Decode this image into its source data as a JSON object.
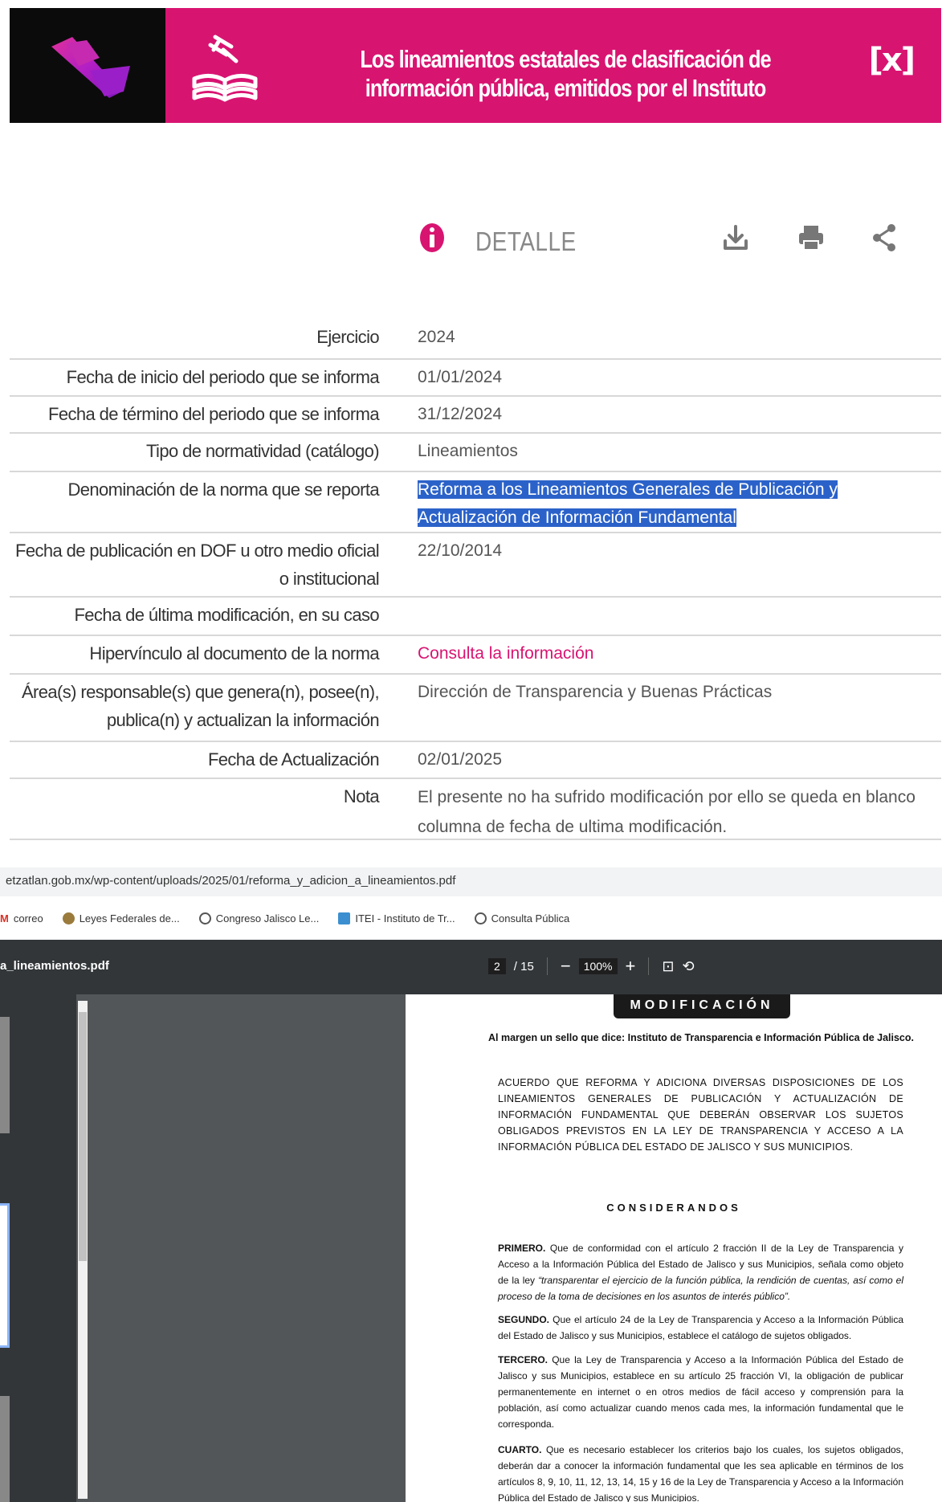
{
  "banner": {
    "title": "Los lineamientos estatales de clasificación de información pública, emitidos por el Instituto",
    "close_label": "[x]",
    "colors": {
      "accent": "#d81471",
      "logo_bg": "#0b0b0b"
    }
  },
  "detail": {
    "title": "DETALLE",
    "icons": [
      "info-icon",
      "download-icon",
      "print-icon",
      "share-icon"
    ]
  },
  "rows": [
    {
      "label": "Ejercicio",
      "value": "2024"
    },
    {
      "label": "Fecha de inicio del periodo que se informa",
      "value": "01/01/2024"
    },
    {
      "label": "Fecha de término del periodo que se informa",
      "value": "31/12/2024"
    },
    {
      "label": "Tipo de normatividad (catálogo)",
      "value": "Lineamientos"
    },
    {
      "label": "Denominación de la norma que se reporta",
      "value": "Reforma a los Lineamientos Generales de Publicación y Actualización de Información Fundamental"
    },
    {
      "label": "Fecha de publicación en DOF u otro medio oficial o institucional",
      "value": "22/10/2014"
    },
    {
      "label": "Fecha de última modificación, en su caso",
      "value": ""
    },
    {
      "label": "Hipervínculo al documento de la norma",
      "value": "Consulta la información"
    },
    {
      "label": "Área(s) responsable(s) que genera(n), posee(n), publica(n) y actualizan la información",
      "value": "Dirección de Transparencia y Buenas Prácticas"
    },
    {
      "label": "Fecha de Actualización",
      "value": "02/01/2025"
    },
    {
      "label": "Nota",
      "value": "El presente no ha sufrido modificación por ello se queda en blanco columna de fecha de ultima modificación."
    }
  ],
  "browser": {
    "url": "etzatlan.gob.mx/wp-content/uploads/2025/01/reforma_y_adicion_a_lineamientos.pdf",
    "bookmarks": [
      "correo",
      "Leyes Federales de...",
      "Congreso Jalisco Le...",
      "ITEI - Instituto de Tr...",
      "Consulta Pública"
    ]
  },
  "pdf": {
    "filename": "a_lineamientos.pdf",
    "page": "2",
    "total": "/ 15",
    "zoom": "100%",
    "section_pill": "MODIFICACIÓN",
    "margen": "Al margen un sello que dice: Instituto de Transparencia e Información Pública de Jalisco.",
    "acuerdo": "ACUERDO QUE REFORMA Y ADICIONA DIVERSAS DISPOSICIONES DE LOS LINEAMIENTOS GENERALES DE PUBLICACIÓN Y ACTUALIZACIÓN DE INFORMACIÓN FUNDAMENTAL QUE DEBERÁN OBSERVAR LOS SUJETOS OBLIGADOS PREVISTOS EN LA LEY DE TRANSPARENCIA Y ACCESO A LA INFORMACIÓN PÚBLICA DEL ESTADO DE JALISCO Y SUS MUNICIPIOS.",
    "considerandos": "CONSIDERANDOS",
    "paragraphs": [
      {
        "lead": "PRIMERO.",
        "text": "Que de conformidad con el artículo 2 fracción II de la Ley de Transparencia y Acceso a la Información Pública del Estado de Jalisco y sus Municipios, señala como objeto de la ley",
        "quote": "“transparentar el ejercicio de la función pública, la rendición de cuentas, así como el proceso de la toma de decisiones en los asuntos de interés público”."
      },
      {
        "lead": "SEGUNDO.",
        "text": "Que el artículo 24 de la Ley de Transparencia y Acceso a la Información Pública del Estado de Jalisco y sus Municipios, establece el catálogo de sujetos obligados.",
        "quote": ""
      },
      {
        "lead": "TERCERO.",
        "text": "Que la Ley de Transparencia y Acceso a la Información Pública del Estado de Jalisco y sus Municipios, establece en su artículo 25 fracción VI, la obligación de publicar permanentemente en internet o en otros medios de fácil acceso y comprensión para la población, así como actualizar cuando menos cada mes, la información fundamental que le corresponda.",
        "quote": ""
      },
      {
        "lead": "CUARTO.",
        "text": "Que es necesario establecer los criterios bajo los cuales, los sujetos obligados, deberán dar a conocer la información fundamental que les sea aplicable en términos de los artículos 8, 9, 10, 11, 12, 13, 14, 15 y 16 de la Ley de Transparencia y Acceso a la Información Pública del Estado de Jalisco y sus Municipios.",
        "quote": ""
      }
    ]
  }
}
